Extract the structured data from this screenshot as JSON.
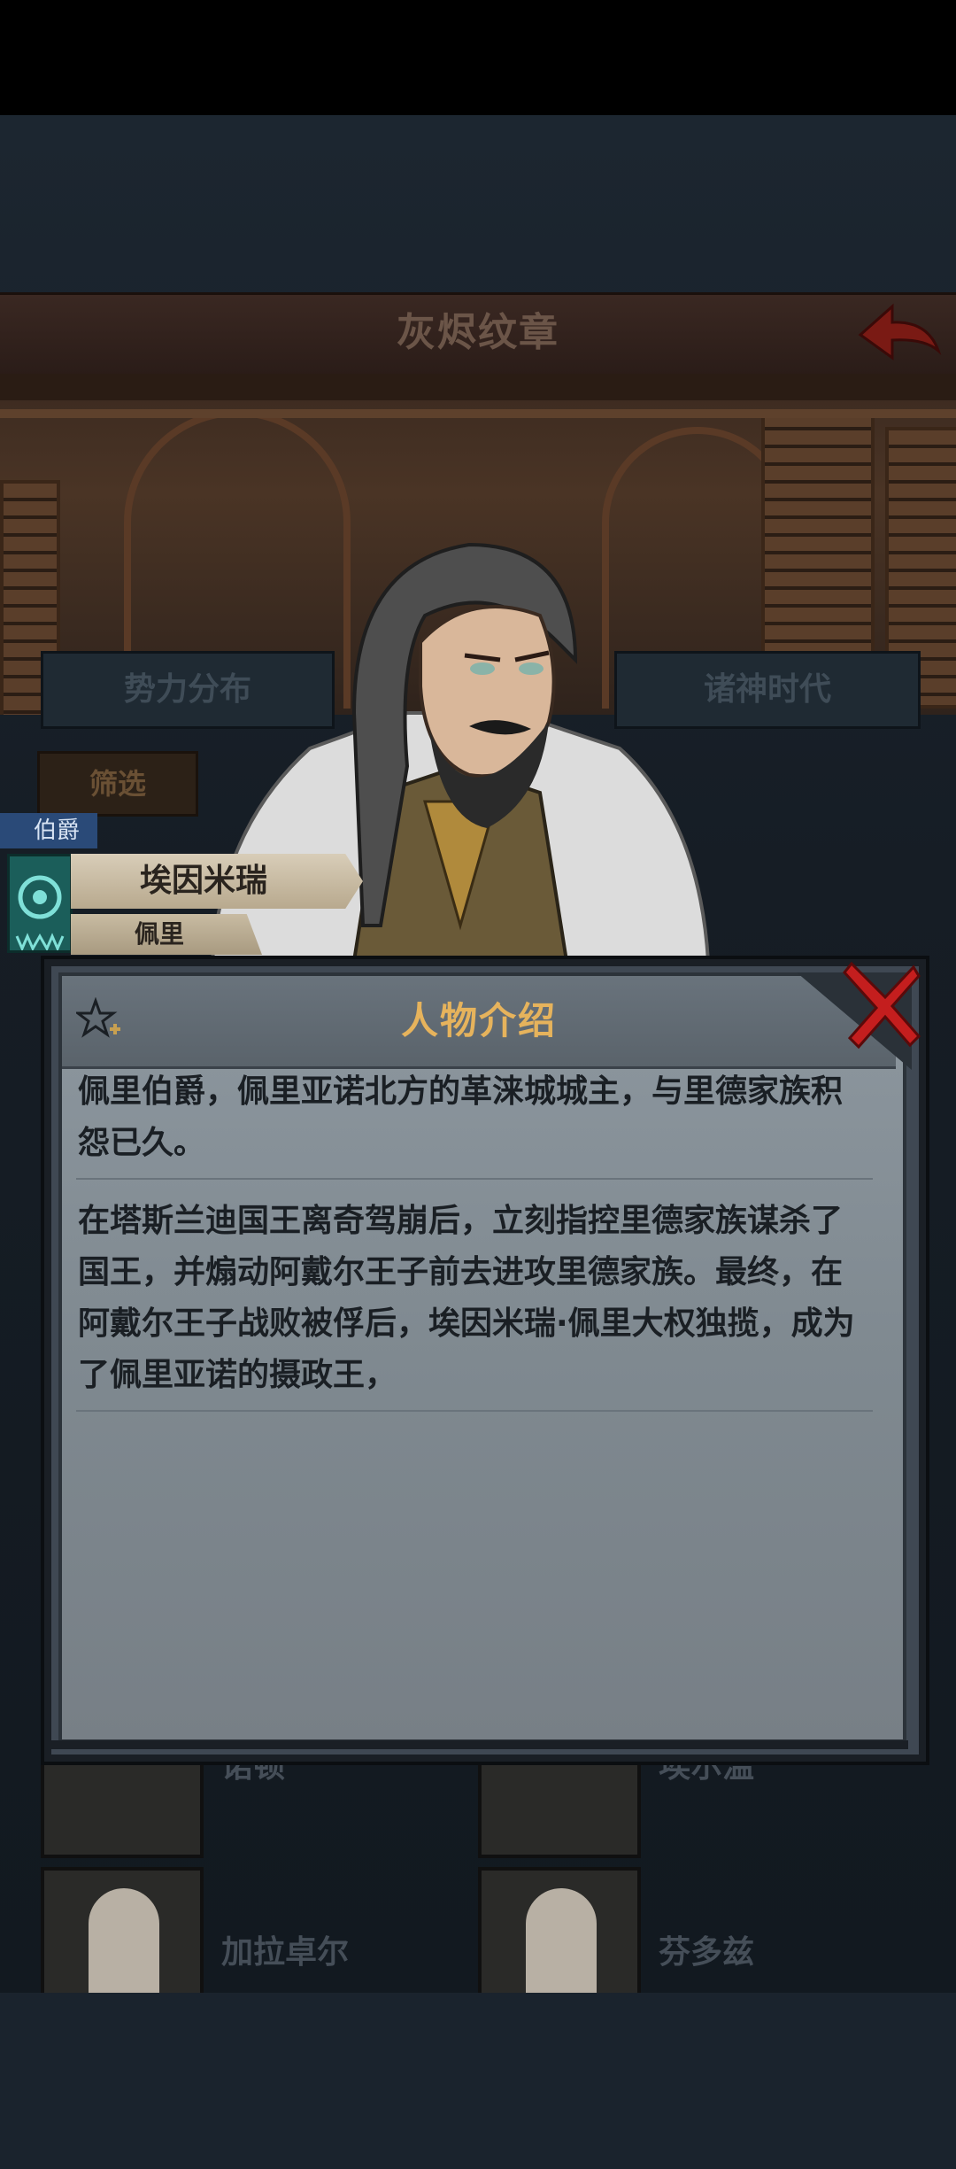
{
  "header": {
    "title": "灰烬纹章"
  },
  "tabs": [
    {
      "label": "势力分布"
    },
    {
      "label": "诸神时代"
    }
  ],
  "filter": {
    "label": "筛选"
  },
  "character": {
    "rank": "伯爵",
    "name": "埃因米瑞",
    "family": "佩里"
  },
  "list_behind": [
    {
      "name": "诺顿"
    },
    {
      "name": "埃尔温"
    },
    {
      "name": "加拉卓尔"
    },
    {
      "name": "芬多兹"
    }
  ],
  "modal": {
    "title": "人物介绍",
    "paragraphs": [
      "佩里伯爵，佩里亚诺北方的革涞城城主，与里德家族积怨已久。",
      "在塔斯兰迪国王离奇驾崩后，立刻指控里德家族谋杀了国王，并煽动阿戴尔王子前去进攻里德家族。最终，在阿戴尔王子战败被俘后，埃因米瑞·佩里大权独揽，成为了佩里亚诺的摄政王，"
    ]
  },
  "colors": {
    "accent_title": "#e6b35c",
    "close_red": "#c41e1e",
    "rank_blue": "#2a4a78",
    "emblem_teal": "#1b5e5a"
  },
  "icons": [
    "back-arrow-icon",
    "close-icon",
    "favorite-star-icon",
    "house-emblem-icon"
  ]
}
